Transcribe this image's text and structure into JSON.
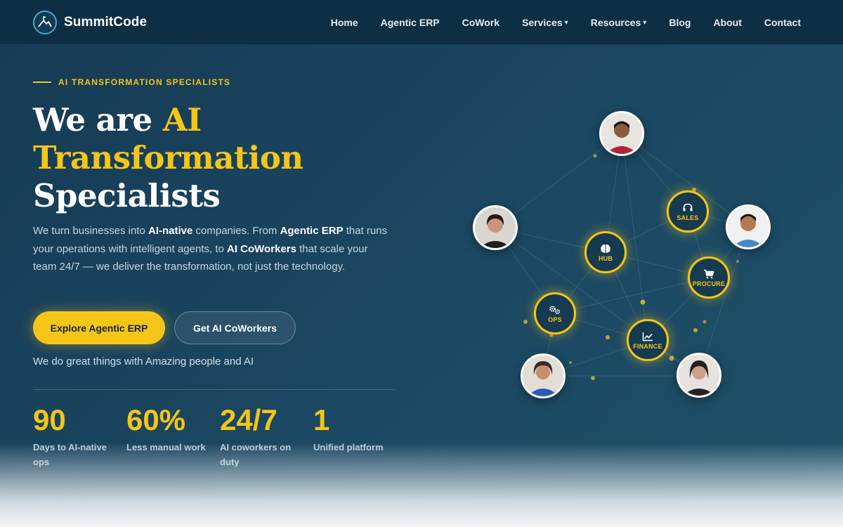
{
  "brand": {
    "name": "SummitCode",
    "logo_icon": "mountain-flag-icon"
  },
  "nav": {
    "items": [
      {
        "label": "Home",
        "has_dropdown": false
      },
      {
        "label": "Agentic ERP",
        "has_dropdown": false
      },
      {
        "label": "CoWork",
        "has_dropdown": false
      },
      {
        "label": "Services",
        "has_dropdown": true
      },
      {
        "label": "Resources",
        "has_dropdown": true
      },
      {
        "label": "Blog",
        "has_dropdown": false
      },
      {
        "label": "About",
        "has_dropdown": false
      },
      {
        "label": "Contact",
        "has_dropdown": false
      }
    ],
    "caret": "▾"
  },
  "hero": {
    "eyebrow": "AI TRANSFORMATION SPECIALISTS",
    "headline_part1": "We are ",
    "headline_accent": "AI Transformation",
    "headline_part2": "Specialists",
    "lead": {
      "t1": "We turn businesses into ",
      "b1": "AI-native",
      "t2": " companies. From ",
      "b2": "Agentic ERP",
      "t3": " that runs your operations with intelligent agents, to ",
      "b3": "AI CoWorkers",
      "t4": " that scale your team 24/7 — we deliver the transformation, not just the technology."
    },
    "primary_cta": "Explore Agentic ERP",
    "secondary_cta": "Get AI CoWorkers",
    "tagline": "We do great things with Amazing people and AI"
  },
  "stats": [
    {
      "value": "90",
      "label": "Days to AI-native ops"
    },
    {
      "value": "60%",
      "label": "Less manual work"
    },
    {
      "value": "24/7",
      "label": "AI coworkers on duty"
    },
    {
      "value": "1",
      "label": "Unified platform"
    }
  ],
  "network": {
    "nodes": [
      {
        "label": "HUB",
        "icon": "brain-icon"
      },
      {
        "label": "SALES",
        "icon": "headset-icon"
      },
      {
        "label": "PROCURE",
        "icon": "cart-icon"
      },
      {
        "label": "OPS",
        "icon": "gears-icon"
      },
      {
        "label": "FINANCE",
        "icon": "chart-icon"
      }
    ],
    "avatars": [
      "team-member-1",
      "team-member-2",
      "team-member-3",
      "team-member-4",
      "team-member-5"
    ]
  },
  "colors": {
    "accent": "#f5c518",
    "nav_bg": "#0e2e44",
    "hero_bg": "#1b4862",
    "text_muted": "#c6d6e1"
  }
}
